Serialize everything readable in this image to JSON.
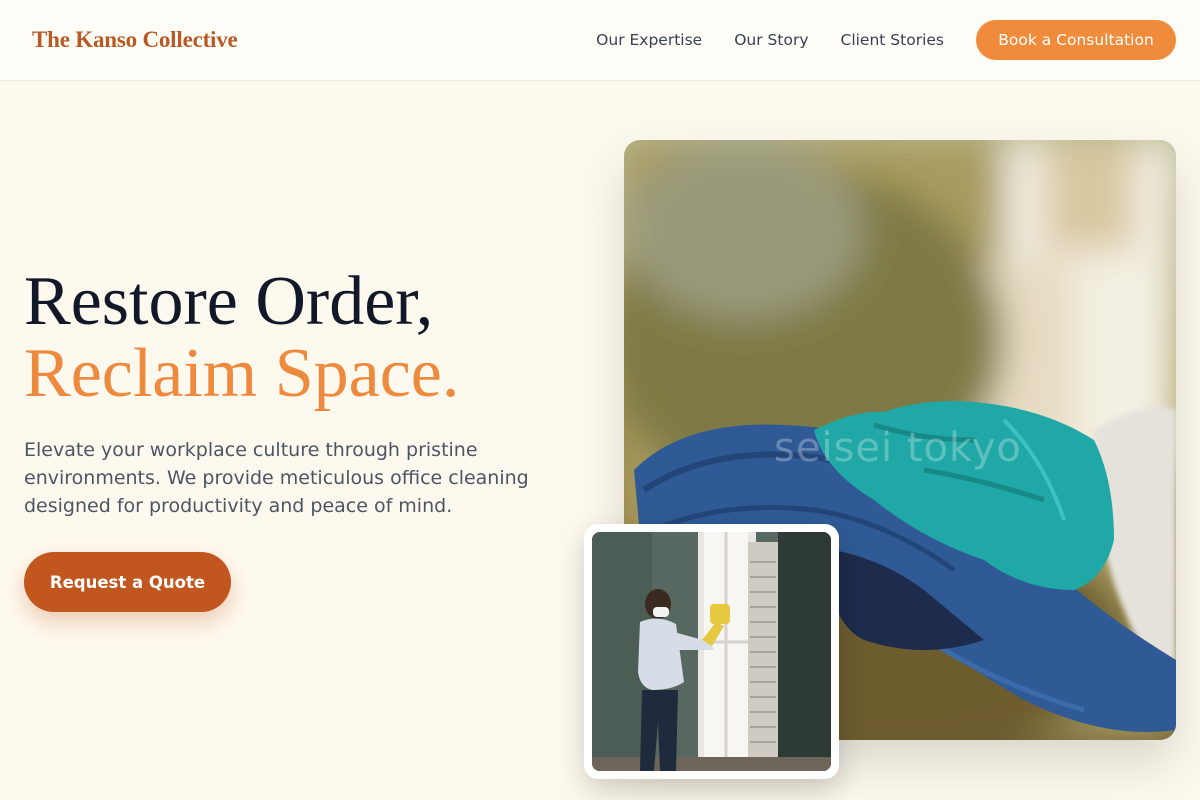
{
  "brand": {
    "name": "The Kanso Collective"
  },
  "nav": {
    "links": [
      {
        "label": "Our Expertise"
      },
      {
        "label": "Our Story"
      },
      {
        "label": "Client Stories"
      }
    ],
    "cta_label": "Book a Consultation"
  },
  "hero": {
    "title_line1": "Restore Order,",
    "title_line2": "Reclaim Space.",
    "subtitle": "Elevate your workplace culture through pristine environments. We provide meticulous office cleaning designed for productivity and peace of mind.",
    "cta_label": "Request a Quote"
  },
  "images": {
    "main_alt": "Gloved hand holding blue cleaning cloth",
    "main_watermark": "seisei tokyo",
    "inset_alt": "Person wearing mask cleaning a window"
  },
  "colors": {
    "brand": "#b85a25",
    "accent": "#ef8b3a",
    "accent_dark": "#c2561f",
    "background": "#fef9ee",
    "heading": "#111827"
  }
}
